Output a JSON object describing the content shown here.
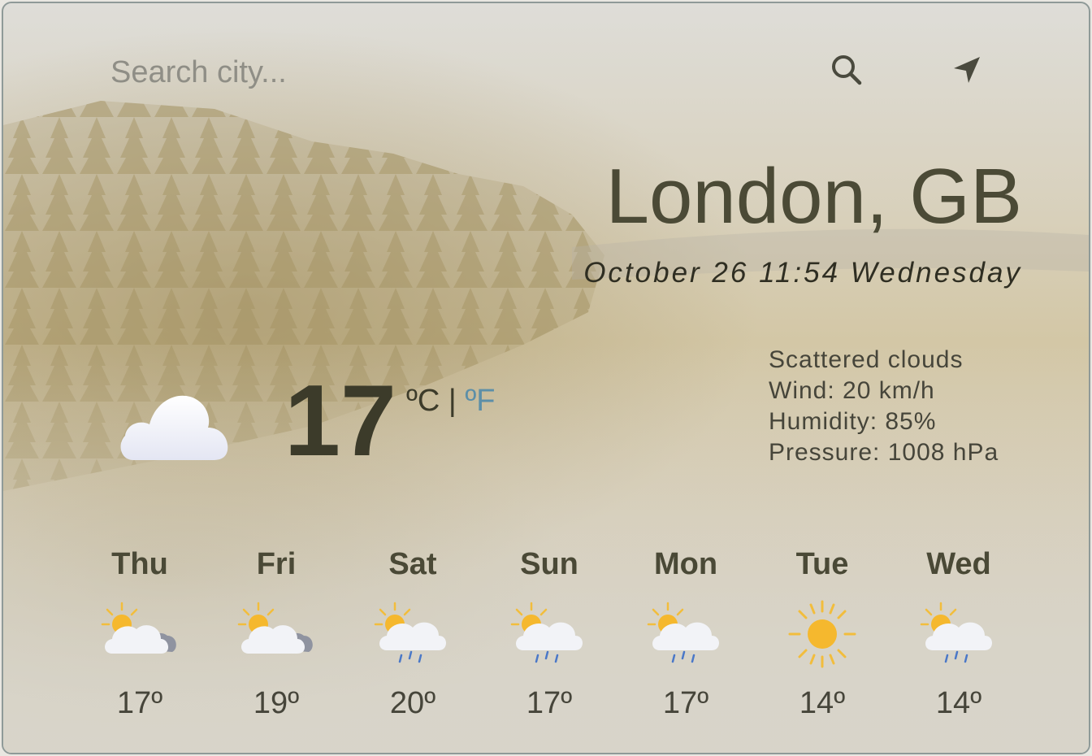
{
  "search": {
    "placeholder": "Search city..."
  },
  "icons": {
    "search": "search-icon",
    "location": "location-arrow-icon"
  },
  "current": {
    "city": "London, GB",
    "datetime": "October 26 11:54 Wednesday",
    "temperature": "17",
    "unit_c": "ºC",
    "unit_sep": "|",
    "unit_f": "ºF",
    "condition": "Scattered clouds",
    "wind": "Wind: 20 km/h",
    "humidity": "Humidity: 85%",
    "pressure": "Pressure: 1008 hPa",
    "icon": "cloud-icon"
  },
  "forecast": [
    {
      "day": "Thu",
      "temp": "17º",
      "icon": "sun-behind-clouds-icon"
    },
    {
      "day": "Fri",
      "temp": "19º",
      "icon": "sun-behind-clouds-icon"
    },
    {
      "day": "Sat",
      "temp": "20º",
      "icon": "sun-behind-rain-cloud-icon"
    },
    {
      "day": "Sun",
      "temp": "17º",
      "icon": "sun-behind-rain-cloud-icon"
    },
    {
      "day": "Mon",
      "temp": "17º",
      "icon": "sun-behind-rain-cloud-icon"
    },
    {
      "day": "Tue",
      "temp": "14º",
      "icon": "sun-icon"
    },
    {
      "day": "Wed",
      "temp": "14º",
      "icon": "sun-behind-rain-cloud-icon"
    }
  ],
  "colors": {
    "text_dark": "#4b4a36",
    "unit_link": "#5c8fa8",
    "border": "#8f9a98"
  }
}
